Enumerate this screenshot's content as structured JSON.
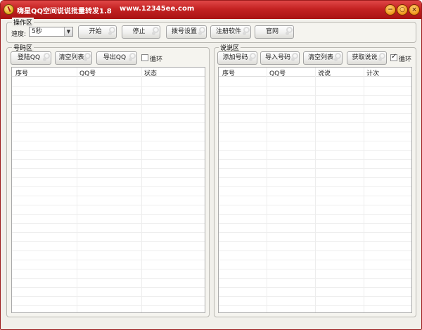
{
  "window": {
    "title": "嗨星QQ空间说说批量转发1.8",
    "url": "www.12345ee.com",
    "controls": {
      "minimize": "−",
      "maximize": "○",
      "close": "×"
    }
  },
  "ops": {
    "group_label": "操作区",
    "speed_label": "速度:",
    "speed_value": "5秒",
    "buttons": {
      "start": "开始",
      "stop": "停止",
      "dial": "拨号设置",
      "register": "注册软件",
      "website": "官网"
    }
  },
  "numbers": {
    "group_label": "号码区",
    "buttons": {
      "login": "登陆QQ",
      "clear": "清空列表",
      "export": "导出QQ"
    },
    "loop_label": "循环",
    "loop_checked": false,
    "columns": [
      "序号",
      "QQ号",
      "状态"
    ]
  },
  "talks": {
    "group_label": "说说区",
    "buttons": {
      "add": "添加号码",
      "import": "导入号码",
      "clear": "清空列表",
      "fetch": "获取说说"
    },
    "loop_label": "循环",
    "loop_checked": true,
    "columns": [
      "序号",
      "QQ号",
      "说说",
      "计次"
    ]
  }
}
